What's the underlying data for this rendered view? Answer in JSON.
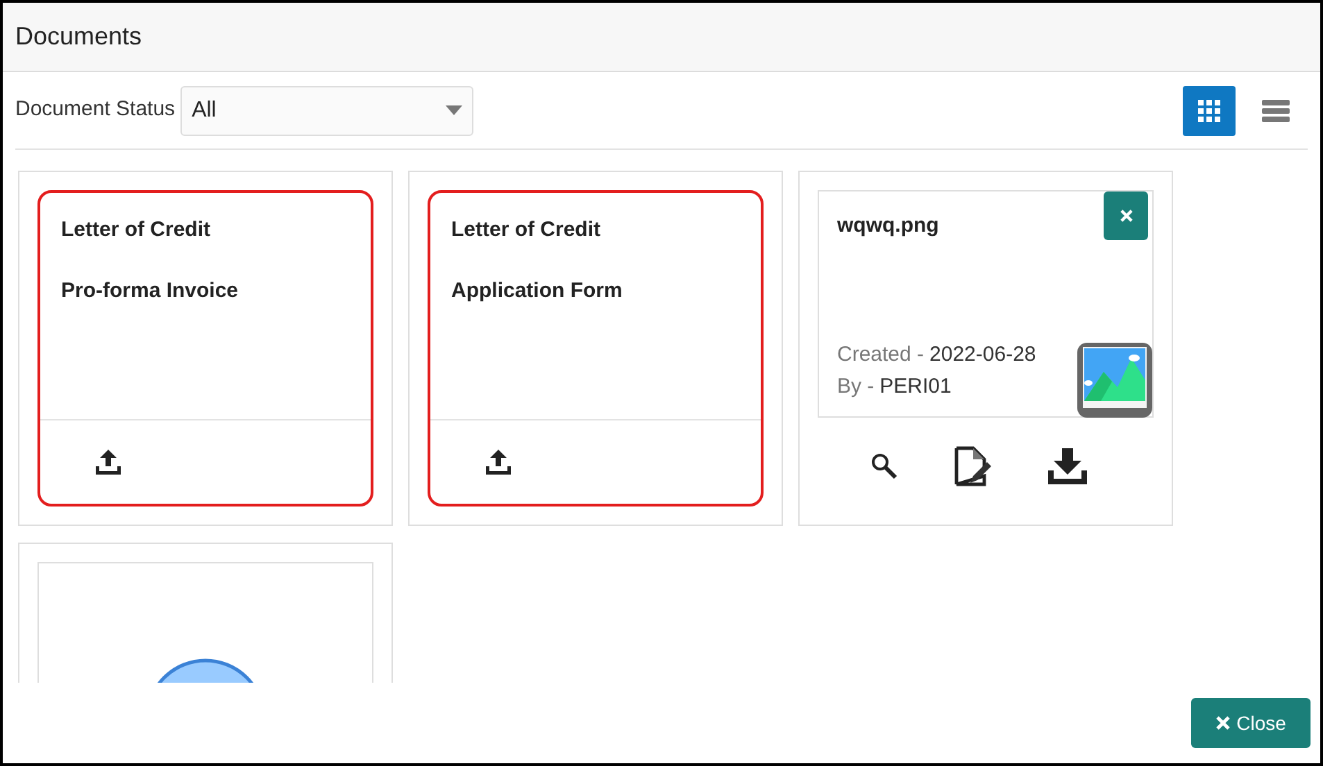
{
  "window": {
    "title": "Documents"
  },
  "filter": {
    "label": "Document Status",
    "value": "All"
  },
  "view_toggle": [
    {
      "kind": "grid",
      "selected": true
    },
    {
      "kind": "list",
      "selected": false
    }
  ],
  "cards": [
    {
      "kind": "required",
      "mandatory": true,
      "title": "Letter of Credit",
      "subtitle": "Pro-forma Invoice"
    },
    {
      "kind": "required",
      "mandatory": true,
      "title": "Letter of Credit",
      "subtitle": "Application Form"
    },
    {
      "kind": "uploaded",
      "file_name": "wqwq.png",
      "created_label": "Created -",
      "created_value": "2022-06-28",
      "by_label": "By -",
      "by_value": "PERI01"
    },
    {
      "kind": "placeholder"
    }
  ],
  "footer": {
    "close_button": "Close"
  }
}
